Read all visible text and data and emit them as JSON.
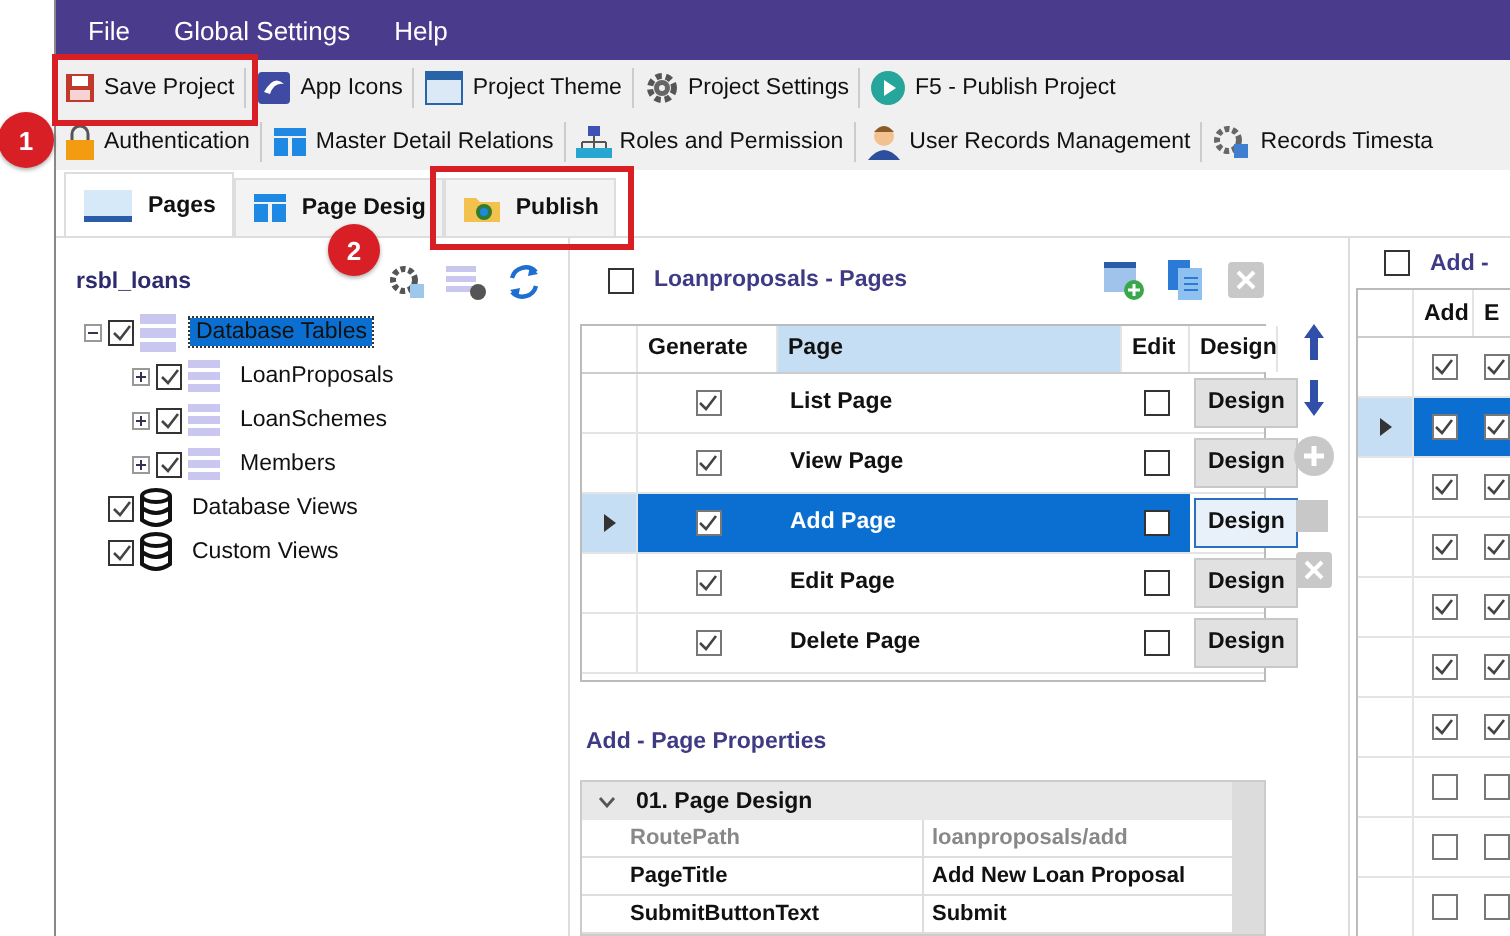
{
  "menu": [
    "File",
    "Global Settings",
    "Help"
  ],
  "toolbar": [
    {
      "label": "Save Project"
    },
    {
      "label": "App Icons"
    },
    {
      "label": "Project Theme"
    },
    {
      "label": "Project Settings"
    },
    {
      "label": "F5 - Publish Project"
    }
  ],
  "toolbar_2": [
    {
      "label": "Authentication"
    },
    {
      "label": "Master Detail Relations"
    },
    {
      "label": "Roles and Permission"
    },
    {
      "label": "User Records Management"
    },
    {
      "label": "Records Timesta"
    }
  ],
  "tabs": [
    {
      "label": "Pages",
      "selected": true
    },
    {
      "label": "Page Desig",
      "selected": false
    },
    {
      "label": "Publish",
      "selected": false
    }
  ],
  "callouts": [
    {
      "number": "1"
    },
    {
      "number": "2"
    }
  ],
  "project": {
    "name": "rsbl_loans"
  },
  "tree": [
    {
      "label": "Database Tables",
      "checked": true,
      "selected": true,
      "expanded": true,
      "kind": "tables",
      "children": [
        {
          "label": "LoanProposals",
          "checked": true,
          "selected": false,
          "expanded": false,
          "kind": "table"
        },
        {
          "label": "LoanSchemes",
          "checked": true,
          "selected": false,
          "expanded": false,
          "kind": "table"
        },
        {
          "label": "Members",
          "checked": true,
          "selected": false,
          "expanded": false,
          "kind": "table"
        }
      ]
    },
    {
      "label": "Database Views",
      "checked": true,
      "selected": false,
      "kind": "views"
    },
    {
      "label": "Custom Views",
      "checked": true,
      "selected": false,
      "kind": "views"
    }
  ],
  "pages": {
    "title": "Loanproposals - Pages",
    "checked": false,
    "columns": [
      "Generate",
      "Page",
      "Edit",
      "Design"
    ],
    "rows": [
      {
        "generate": true,
        "page": "List Page",
        "edit": false,
        "button": "Design",
        "selected": false
      },
      {
        "generate": true,
        "page": "View Page",
        "edit": false,
        "button": "Design",
        "selected": false
      },
      {
        "generate": true,
        "page": "Add Page",
        "edit": false,
        "button": "Design",
        "selected": true
      },
      {
        "generate": true,
        "page": "Edit Page",
        "edit": false,
        "button": "Design",
        "selected": false
      },
      {
        "generate": true,
        "page": "Delete Page",
        "edit": false,
        "button": "Design",
        "selected": false
      }
    ]
  },
  "properties": {
    "title": "Add - Page Properties",
    "section": "01. Page Design",
    "expanded": true,
    "rows": [
      {
        "name": "RoutePath",
        "value": "loanproposals/add",
        "disabled": true
      },
      {
        "name": "PageTitle",
        "value": "Add New Loan Proposal",
        "disabled": false
      },
      {
        "name": "SubmitButtonText",
        "value": "Submit",
        "disabled": false
      }
    ]
  },
  "fields": {
    "title": "Add -",
    "checked": false,
    "columns": [
      "Add",
      "E"
    ],
    "rows": [
      {
        "add": true,
        "edit": true,
        "selected": false
      },
      {
        "add": true,
        "edit": true,
        "selected": true
      },
      {
        "add": true,
        "edit": true,
        "selected": false
      },
      {
        "add": true,
        "edit": true,
        "selected": false
      },
      {
        "add": true,
        "edit": true,
        "selected": false
      },
      {
        "add": true,
        "edit": true,
        "selected": false
      },
      {
        "add": true,
        "edit": true,
        "selected": false
      },
      {
        "add": false,
        "edit": false,
        "selected": false
      },
      {
        "add": false,
        "edit": false,
        "selected": false
      },
      {
        "add": false,
        "edit": false,
        "selected": false
      }
    ]
  }
}
